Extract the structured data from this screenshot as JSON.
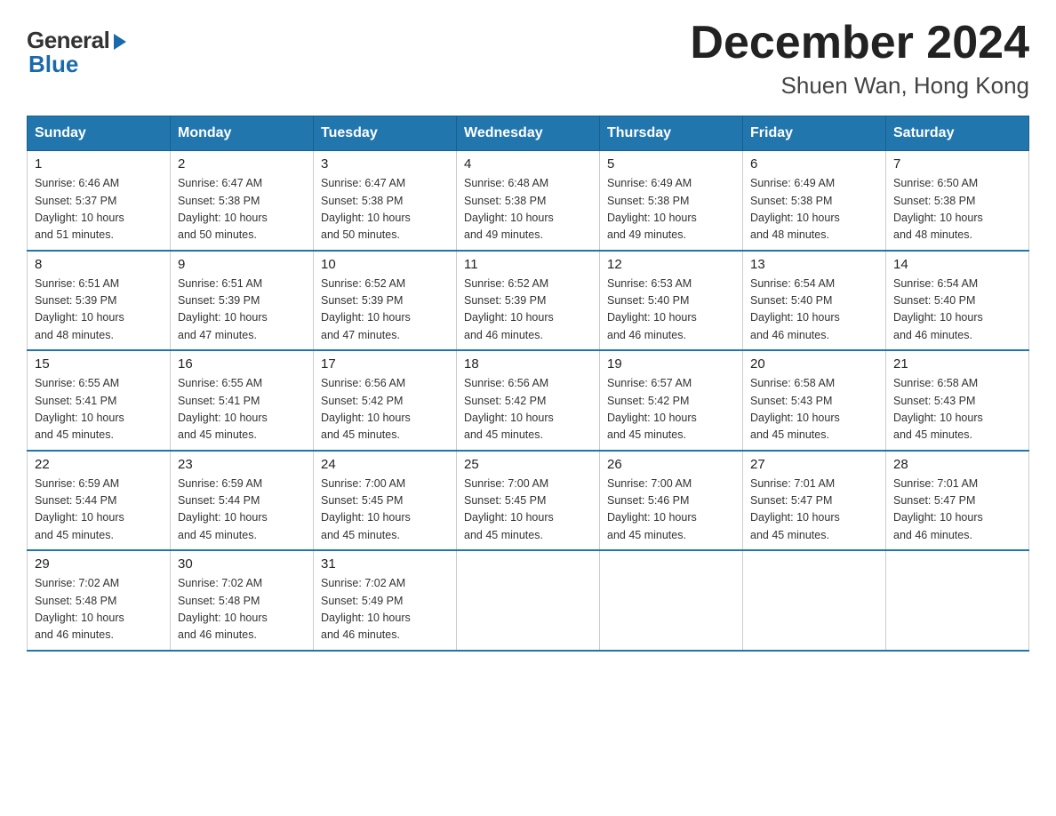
{
  "logo": {
    "general_text": "General",
    "blue_text": "Blue"
  },
  "header": {
    "title": "December 2024",
    "location": "Shuen Wan, Hong Kong"
  },
  "days_of_week": [
    "Sunday",
    "Monday",
    "Tuesday",
    "Wednesday",
    "Thursday",
    "Friday",
    "Saturday"
  ],
  "weeks": [
    [
      {
        "day": "1",
        "info": "Sunrise: 6:46 AM\nSunset: 5:37 PM\nDaylight: 10 hours\nand 51 minutes."
      },
      {
        "day": "2",
        "info": "Sunrise: 6:47 AM\nSunset: 5:38 PM\nDaylight: 10 hours\nand 50 minutes."
      },
      {
        "day": "3",
        "info": "Sunrise: 6:47 AM\nSunset: 5:38 PM\nDaylight: 10 hours\nand 50 minutes."
      },
      {
        "day": "4",
        "info": "Sunrise: 6:48 AM\nSunset: 5:38 PM\nDaylight: 10 hours\nand 49 minutes."
      },
      {
        "day": "5",
        "info": "Sunrise: 6:49 AM\nSunset: 5:38 PM\nDaylight: 10 hours\nand 49 minutes."
      },
      {
        "day": "6",
        "info": "Sunrise: 6:49 AM\nSunset: 5:38 PM\nDaylight: 10 hours\nand 48 minutes."
      },
      {
        "day": "7",
        "info": "Sunrise: 6:50 AM\nSunset: 5:38 PM\nDaylight: 10 hours\nand 48 minutes."
      }
    ],
    [
      {
        "day": "8",
        "info": "Sunrise: 6:51 AM\nSunset: 5:39 PM\nDaylight: 10 hours\nand 48 minutes."
      },
      {
        "day": "9",
        "info": "Sunrise: 6:51 AM\nSunset: 5:39 PM\nDaylight: 10 hours\nand 47 minutes."
      },
      {
        "day": "10",
        "info": "Sunrise: 6:52 AM\nSunset: 5:39 PM\nDaylight: 10 hours\nand 47 minutes."
      },
      {
        "day": "11",
        "info": "Sunrise: 6:52 AM\nSunset: 5:39 PM\nDaylight: 10 hours\nand 46 minutes."
      },
      {
        "day": "12",
        "info": "Sunrise: 6:53 AM\nSunset: 5:40 PM\nDaylight: 10 hours\nand 46 minutes."
      },
      {
        "day": "13",
        "info": "Sunrise: 6:54 AM\nSunset: 5:40 PM\nDaylight: 10 hours\nand 46 minutes."
      },
      {
        "day": "14",
        "info": "Sunrise: 6:54 AM\nSunset: 5:40 PM\nDaylight: 10 hours\nand 46 minutes."
      }
    ],
    [
      {
        "day": "15",
        "info": "Sunrise: 6:55 AM\nSunset: 5:41 PM\nDaylight: 10 hours\nand 45 minutes."
      },
      {
        "day": "16",
        "info": "Sunrise: 6:55 AM\nSunset: 5:41 PM\nDaylight: 10 hours\nand 45 minutes."
      },
      {
        "day": "17",
        "info": "Sunrise: 6:56 AM\nSunset: 5:42 PM\nDaylight: 10 hours\nand 45 minutes."
      },
      {
        "day": "18",
        "info": "Sunrise: 6:56 AM\nSunset: 5:42 PM\nDaylight: 10 hours\nand 45 minutes."
      },
      {
        "day": "19",
        "info": "Sunrise: 6:57 AM\nSunset: 5:42 PM\nDaylight: 10 hours\nand 45 minutes."
      },
      {
        "day": "20",
        "info": "Sunrise: 6:58 AM\nSunset: 5:43 PM\nDaylight: 10 hours\nand 45 minutes."
      },
      {
        "day": "21",
        "info": "Sunrise: 6:58 AM\nSunset: 5:43 PM\nDaylight: 10 hours\nand 45 minutes."
      }
    ],
    [
      {
        "day": "22",
        "info": "Sunrise: 6:59 AM\nSunset: 5:44 PM\nDaylight: 10 hours\nand 45 minutes."
      },
      {
        "day": "23",
        "info": "Sunrise: 6:59 AM\nSunset: 5:44 PM\nDaylight: 10 hours\nand 45 minutes."
      },
      {
        "day": "24",
        "info": "Sunrise: 7:00 AM\nSunset: 5:45 PM\nDaylight: 10 hours\nand 45 minutes."
      },
      {
        "day": "25",
        "info": "Sunrise: 7:00 AM\nSunset: 5:45 PM\nDaylight: 10 hours\nand 45 minutes."
      },
      {
        "day": "26",
        "info": "Sunrise: 7:00 AM\nSunset: 5:46 PM\nDaylight: 10 hours\nand 45 minutes."
      },
      {
        "day": "27",
        "info": "Sunrise: 7:01 AM\nSunset: 5:47 PM\nDaylight: 10 hours\nand 45 minutes."
      },
      {
        "day": "28",
        "info": "Sunrise: 7:01 AM\nSunset: 5:47 PM\nDaylight: 10 hours\nand 46 minutes."
      }
    ],
    [
      {
        "day": "29",
        "info": "Sunrise: 7:02 AM\nSunset: 5:48 PM\nDaylight: 10 hours\nand 46 minutes."
      },
      {
        "day": "30",
        "info": "Sunrise: 7:02 AM\nSunset: 5:48 PM\nDaylight: 10 hours\nand 46 minutes."
      },
      {
        "day": "31",
        "info": "Sunrise: 7:02 AM\nSunset: 5:49 PM\nDaylight: 10 hours\nand 46 minutes."
      },
      null,
      null,
      null,
      null
    ]
  ]
}
